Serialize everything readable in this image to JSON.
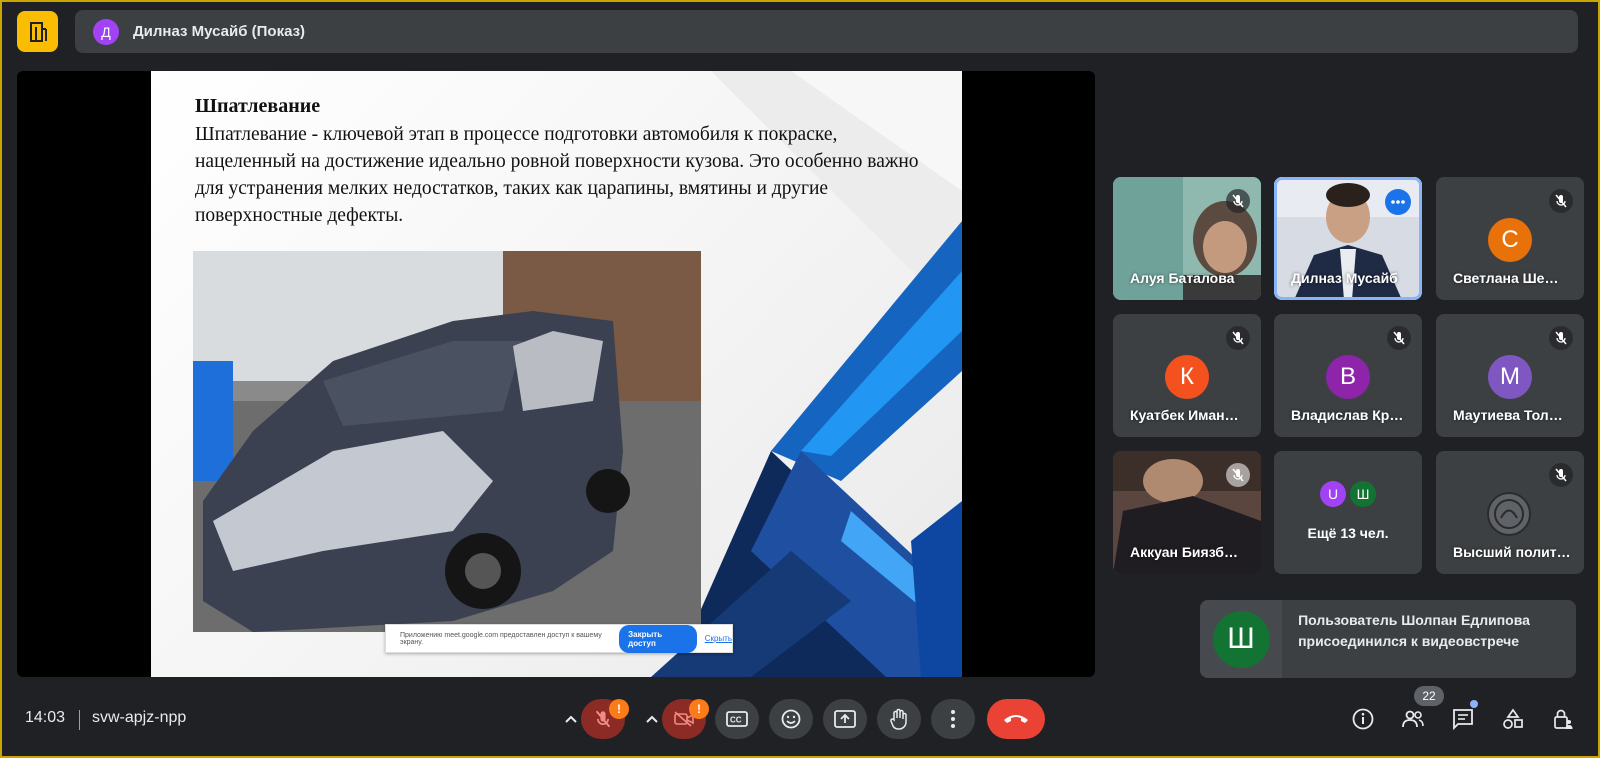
{
  "presenter": {
    "initial": "Д",
    "label": "Дилназ Мусайб (Показ)"
  },
  "slide": {
    "title": "Шпатлевание",
    "body": "Шпатлевание - ключевой этап в процессе подготовки автомобиля к покраске, нацеленный на достижение идеально ровной поверхности кузова. Это особенно важно для устранения мелких недостатков, таких как царапины, вмятины и другие поверхностные дефекты.",
    "share_notice": {
      "text": "Приложению meet.google.com предоставлен доступ к вашему экрану.",
      "stop_label": "Закрыть доступ",
      "hide_label": "Скрыть"
    }
  },
  "participants": [
    {
      "name": "Алуя Баталова",
      "type": "video",
      "muted": true
    },
    {
      "name": "Дилназ Мусайб",
      "type": "video",
      "active": true
    },
    {
      "name": "Светлана Ше…",
      "initial": "С",
      "color": "#e8710a",
      "muted": true
    },
    {
      "name": "Куатбек Иман…",
      "initial": "К",
      "color": "#f4511e",
      "muted": true
    },
    {
      "name": "Владислав Кр…",
      "initial": "В",
      "color": "#8e24aa",
      "muted": true
    },
    {
      "name": "Маутиева Тол…",
      "initial": "М",
      "color": "#7e57c2",
      "muted": true
    },
    {
      "name": "Аккуан Биязб…",
      "type": "video",
      "muted": true
    },
    {
      "name": "Ещё 13 чел.",
      "type": "more",
      "initials": [
        "U",
        "Ш"
      ],
      "colors": [
        "#a142f4",
        "#137333"
      ]
    },
    {
      "name": "Высший полит…",
      "type": "logo",
      "muted": true
    }
  ],
  "toast": {
    "initial": "Ш",
    "message": "Пользователь Шолпан Едлипова присоединился к видеовстрече"
  },
  "bottom": {
    "time": "14:03",
    "meeting_code": "svw-apjz-npp",
    "people_count": "22",
    "warn": "!"
  },
  "colors": {
    "accent": "#1a73e8",
    "end_call": "#ea4335",
    "warning": "#fa7b17"
  }
}
